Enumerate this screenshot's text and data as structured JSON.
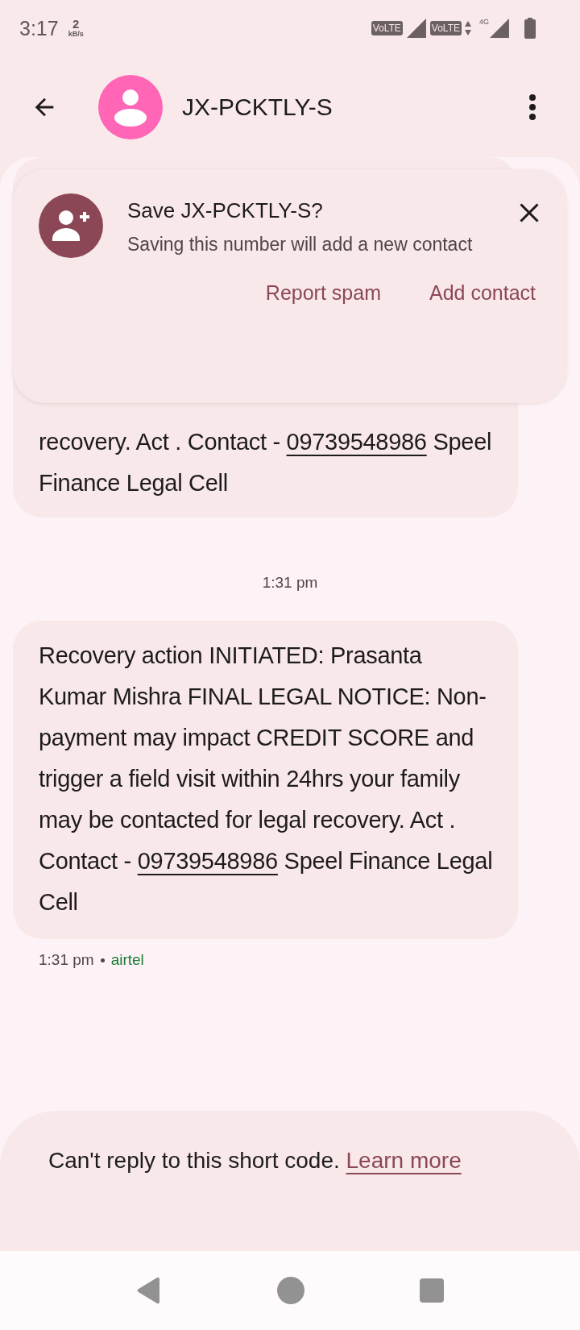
{
  "status_bar": {
    "time": "3:17",
    "speed_value": "2",
    "speed_unit": "kB/s",
    "sim_labels": [
      "VoLTE",
      "VoLTE"
    ],
    "network_type": "4G"
  },
  "header": {
    "title": "JX-PCKTLY-S"
  },
  "save_prompt": {
    "title": "Save JX-PCKTLY-S?",
    "subtitle": "Saving this number will add a new contact",
    "actions": [
      "Report spam",
      "Add contact"
    ]
  },
  "messages": [
    {
      "kind": "message",
      "segments": [
        {
          "kind": "text",
          "text": "recovery. Act . Contact - "
        },
        {
          "kind": "link",
          "text": "09739548986"
        },
        {
          "kind": "text",
          "text": " Speel Finance Legal Cell"
        }
      ]
    },
    {
      "kind": "timestamp",
      "text": "1:31 pm"
    },
    {
      "kind": "message",
      "segments": [
        {
          "kind": "text",
          "text": "Recovery action INITIATED: Prasanta Kumar Mishra FINAL LEGAL NOTICE: Non-payment may impact CREDIT SCORE and trigger a field visit within 24hrs your family may be contacted for legal recovery. Act . Contact - "
        },
        {
          "kind": "link",
          "text": "09739548986"
        },
        {
          "kind": "text",
          "text": " Speel Finance Legal Cell"
        }
      ],
      "time": "1:31 pm",
      "carrier": "airtel"
    }
  ],
  "reply_notice": {
    "text": "Can't reply to this short code. ",
    "link": "Learn more"
  }
}
